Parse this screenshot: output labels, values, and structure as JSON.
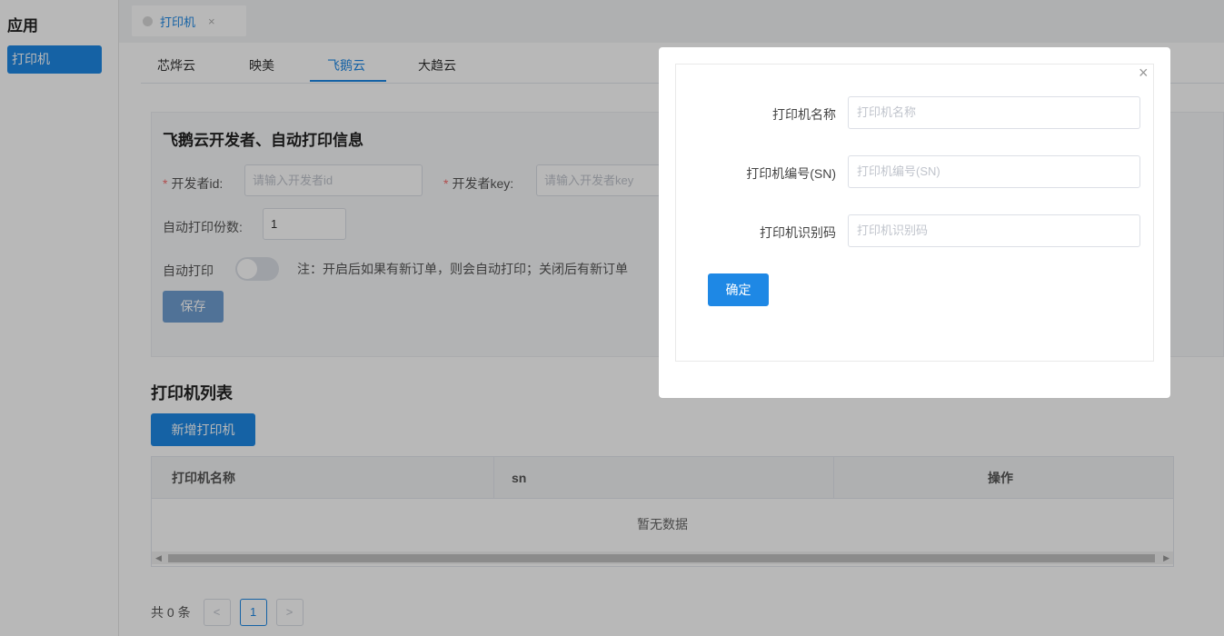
{
  "sidebar": {
    "title": "应用",
    "items": [
      {
        "label": "打印机"
      }
    ]
  },
  "page_tabs": [
    {
      "label": "打印机",
      "close": "×"
    }
  ],
  "provider_tabs": [
    {
      "label": "芯烨云"
    },
    {
      "label": "映美"
    },
    {
      "label": "飞鹅云",
      "active": true
    },
    {
      "label": "大趋云"
    }
  ],
  "dev_panel": {
    "title": "飞鹅云开发者、自动打印信息",
    "developer_id_label": "开发者id:",
    "developer_id_placeholder": "请输入开发者id",
    "developer_key_label": "开发者key:",
    "developer_key_placeholder": "请输入开发者key",
    "copies_label": "自动打印份数:",
    "copies_value": "1",
    "auto_print_label": "自动打印",
    "auto_print_enabled": false,
    "note": "注：开启后如果有新订单，则会自动打印；关闭后有新订单",
    "save_label": "保存"
  },
  "printer_list": {
    "title": "打印机列表",
    "add_label": "新增打印机",
    "columns": [
      "打印机名称",
      "sn",
      "操作"
    ],
    "empty_text": "暂无数据"
  },
  "pagination": {
    "total": "共 0 条",
    "prev": "<",
    "current": "1",
    "next": ">"
  },
  "modal": {
    "close": "×",
    "fields": [
      {
        "label": "打印机名称",
        "placeholder": "打印机名称"
      },
      {
        "label": "打印机编号(SN)",
        "placeholder": "打印机编号(SN)"
      },
      {
        "label": "打印机识别码",
        "placeholder": "打印机识别码"
      }
    ],
    "confirm_label": "确定"
  },
  "colors": {
    "primary": "#1e88e5",
    "required": "#f56c6c"
  }
}
